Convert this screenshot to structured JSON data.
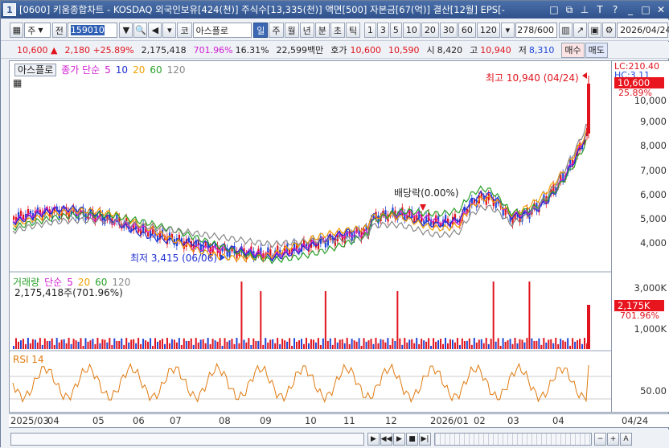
{
  "window": {
    "number": "1",
    "title": "[0600] 키움종합차트 - KOSDAQ 외국인보유[424(천)] 주식수[13,335(천)] 액면[500] 자본금[67(억)] 결산[12월] EPS[-"
  },
  "toolbar": {
    "period_type": "주",
    "range_label": "전",
    "stock_code": "159010",
    "code_btn": "코",
    "stock_name": "아스플로",
    "period_buttons": [
      "일",
      "주",
      "월",
      "년",
      "분",
      "초",
      "틱"
    ],
    "interval_buttons": [
      "1",
      "3",
      "5",
      "10",
      "20",
      "30",
      "60",
      "120"
    ],
    "count": "278/600",
    "date": "2026/04/24",
    "buy_button": "매수",
    "sell_button": "매도"
  },
  "quote": {
    "price": "10,600",
    "change": "2,180",
    "change_pct": "+25.89%",
    "volume": "2,175,418",
    "volume_ratio": "701.96%",
    "turnover": "16.31%",
    "amount": "22,599백만",
    "bid_label": "호가",
    "bid": "10,600",
    "ask": "10,590",
    "open_label": "시",
    "open": "8,420",
    "high_label": "고",
    "high": "10,940",
    "low_label": "저",
    "low": "8,310"
  },
  "price_pane": {
    "stock_label": "아스플로",
    "ma_label": "종가 단순",
    "ma_periods": [
      "5",
      "10",
      "20",
      "60",
      "120"
    ],
    "high_annotation": "최고 10,940 (04/24)",
    "low_annotation": "최저 3,415 (06/06)",
    "dividend_annotation": "배당락(0.00%)",
    "lc_label": "LC:210.40",
    "hc_label": "HC:3.11",
    "current_price_box": "10,600",
    "current_pct": "25.89%",
    "y_ticks": [
      "10,000",
      "9,000",
      "8,000",
      "7,000",
      "6,000",
      "5,000",
      "4,000"
    ]
  },
  "volume_pane": {
    "label": "거래량",
    "ma_label": "단순",
    "ma_periods": [
      "5",
      "20",
      "60",
      "120"
    ],
    "current_text": "2,175,418주(701.96%)",
    "y_ticks": [
      "3,000K",
      "2,000K",
      "1,000K"
    ],
    "current_box": "2,175K",
    "current_pct": "701.96%"
  },
  "rsi_pane": {
    "label": "RSI 14",
    "y_tick": "50.00"
  },
  "time_axis": {
    "labels": [
      "2025/03",
      "04",
      "05",
      "06",
      "07",
      "08",
      "09",
      "10",
      "11",
      "12",
      "2026/01",
      "02",
      "03",
      "04"
    ],
    "right_label": "04/24"
  },
  "colors": {
    "up": "#e0141e",
    "down": "#1f47d8",
    "ma5": "#d01ed0",
    "ma10": "#1f2fd0",
    "ma20": "#f0a000",
    "ma60": "#2aa02a",
    "ma120": "#888888",
    "rsi": "#e07a10"
  },
  "icons": [
    "window-icon",
    "minimize-icon",
    "restore-icon",
    "pin-icon",
    "text-icon",
    "help-icon",
    "close-icon",
    "dropdown-icon",
    "speaker-icon",
    "settings-icon",
    "save-icon",
    "grid-icon"
  ]
}
